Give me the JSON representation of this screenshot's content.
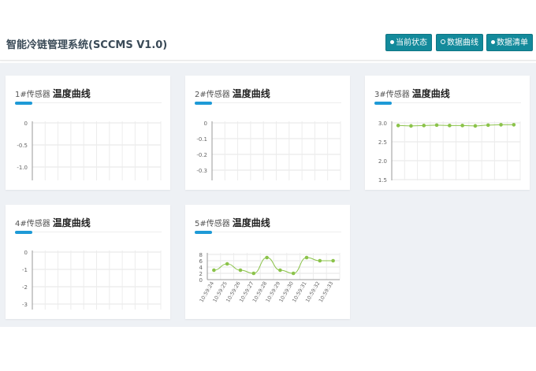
{
  "header": {
    "title": "智能冷链管理系统(SCCMS V1.0)",
    "buttons": [
      {
        "label": "当前状态",
        "icon": "dot-icon"
      },
      {
        "label": "数据曲线",
        "icon": "radio-icon"
      },
      {
        "label": "数据清单",
        "icon": "dot-icon"
      }
    ]
  },
  "cards": [
    {
      "prefix": "1#传感器",
      "title": "温度曲线"
    },
    {
      "prefix": "2#传感器",
      "title": "温度曲线"
    },
    {
      "prefix": "3#传感器",
      "title": "温度曲线"
    },
    {
      "prefix": "4#传感器",
      "title": "温度曲线"
    },
    {
      "prefix": "5#传感器",
      "title": "温度曲线"
    }
  ],
  "colors": {
    "accent": "#1e9ad6",
    "button": "#138a9b",
    "series": "#8bc34a"
  },
  "chart_data": [
    {
      "type": "line",
      "yticks": [
        "0",
        "-0.5",
        "-1.0"
      ],
      "ylim": [
        -1.0,
        0
      ],
      "x": [],
      "values": []
    },
    {
      "type": "line",
      "yticks": [
        "0",
        "-0.1",
        "-0.2",
        "-0.3"
      ],
      "ylim": [
        -0.3,
        0
      ],
      "x": [],
      "values": []
    },
    {
      "type": "line",
      "yticks": [
        "3.0",
        "2.5",
        "2.0",
        "1.5"
      ],
      "ylim": [
        1.5,
        3.0
      ],
      "x": [],
      "values": [
        2.93,
        2.92,
        2.93,
        2.94,
        2.93,
        2.93,
        2.92,
        2.94,
        2.95,
        2.95
      ]
    },
    {
      "type": "line",
      "yticks": [
        "0",
        "-1",
        "-2",
        "-3"
      ],
      "ylim": [
        -3,
        0
      ],
      "x": [],
      "values": []
    },
    {
      "type": "line",
      "yticks": [
        "8",
        "6",
        "4",
        "2",
        "0"
      ],
      "ylim": [
        0,
        8
      ],
      "x": [
        "10:59:24",
        "10:59:25",
        "10:59:26",
        "10:59:27",
        "10:59:28",
        "10:59:29",
        "10:59:30",
        "10:59:31",
        "10:59:32",
        "10:59:33"
      ],
      "values": [
        3,
        5,
        3,
        2,
        7,
        3,
        2,
        7,
        6,
        6
      ]
    }
  ]
}
